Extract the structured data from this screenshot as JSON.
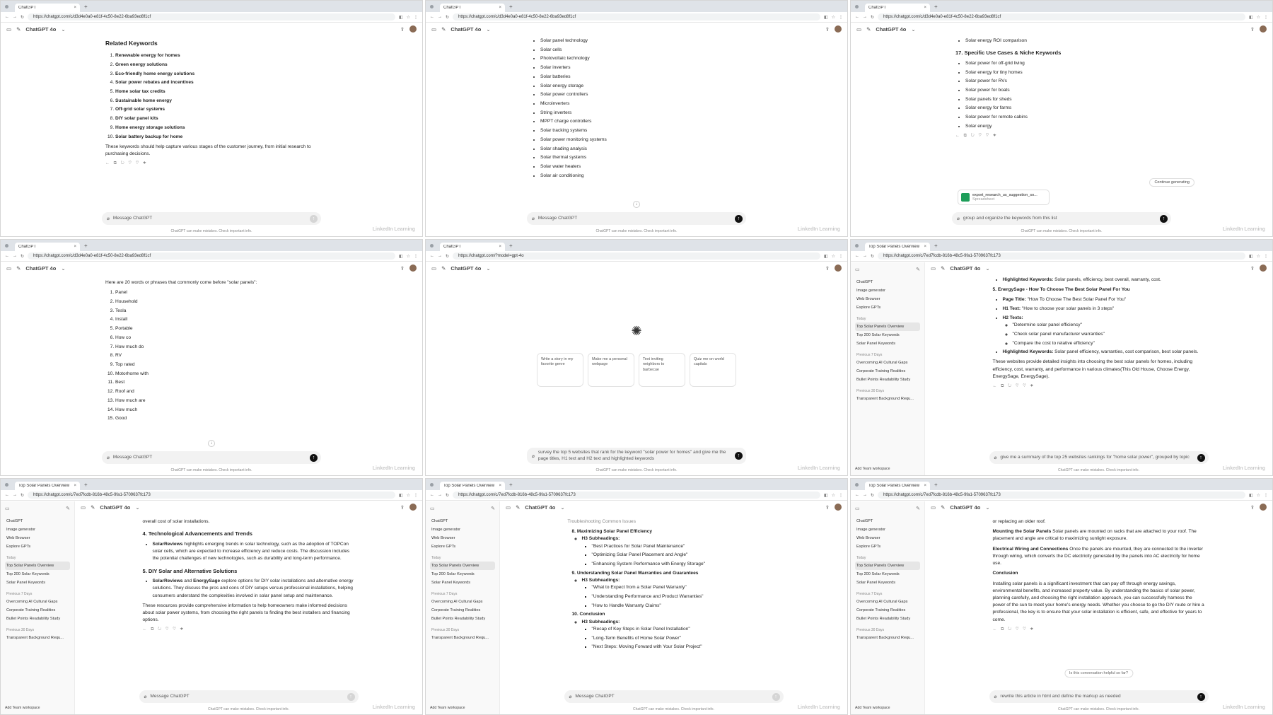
{
  "common": {
    "model": "ChatGPT 4o",
    "placeholder": "Message ChatGPT",
    "disclaimer": "ChatGPT can make mistakes. Check important info.",
    "watermark": "LinkedIn Learning",
    "actions": "← ⧉ ↻ ♡ ♡ ✦"
  },
  "panels": [
    {
      "tab": "ChatGPT",
      "url": "https://chatgpt.com/c/d3d4e0a0-e81f-4c50-8e22-6ba93ed8f1cf",
      "heading": "Related Keywords",
      "items": [
        "Renewable energy for homes",
        "Green energy solutions",
        "Eco-friendly home energy solutions",
        "Solar power rebates and incentives",
        "Home solar tax credits",
        "Sustainable home energy",
        "Off-grid solar systems",
        "DIY solar panel kits",
        "Home energy storage solutions",
        "Solar battery backup for home"
      ],
      "para": "These keywords should help capture various stages of the customer journey, from initial research to purchasing decisions."
    },
    {
      "tab": "ChatGPT",
      "url": "https://chatgpt.com/c/d3d4e0a0-e81f-4c50-8e22-6ba93ed8f1cf",
      "items": [
        "Solar panel technology",
        "Solar cells",
        "Photovoltaic technology",
        "Solar inverters",
        "Solar batteries",
        "Solar energy storage",
        "Solar power controllers",
        "Microinverters",
        "String inverters",
        "MPPT charge controllers",
        "Solar tracking systems",
        "Solar power monitoring systems",
        "Solar shading analysis",
        "Solar thermal systems",
        "Solar water heaters",
        "Solar air conditioning"
      ]
    },
    {
      "tab": "ChatGPT",
      "url": "https://chatgpt.com/c/d3d4e0a0-e81f-4c50-8e22-6ba93ed8f1cf",
      "top_item": "Solar energy ROI comparison",
      "heading": "17. Specific Use Cases & Niche Keywords",
      "items": [
        "Solar power for off-grid living",
        "Solar energy for tiny homes",
        "Solar power for RVs",
        "Solar power for boats",
        "Solar panels for sheds",
        "Solar energy for farms",
        "Solar power for remote cabins",
        "Solar energy"
      ],
      "continue": "Continue generating",
      "file_name": "export_research_us_suggestion_so...",
      "file_type": "Spreadsheet",
      "input": "group and organize the keywords from this list"
    },
    {
      "tab": "ChatGPT",
      "url": "https://chatgpt.com/c/d3d4e0a0-e81f-4c50-8e22-6ba93ed8f1cf",
      "intro": "Here are 20 words or phrases that commonly come before \"solar panels\":",
      "items": [
        "Panel",
        "Household",
        "Tesla",
        "Install",
        "Portable",
        "How co",
        "How much do",
        "RV",
        "Top rated",
        "Motorhome with",
        "Best",
        "Roof and",
        "How much are",
        "How much",
        "Good"
      ]
    },
    {
      "tab": "ChatGPT",
      "url": "https://chatgpt.com/?model=gpt-4o",
      "cards": [
        "Write a story in my favorite genre",
        "Make me a personal webpage",
        "Text inviting neighbors to barbecue",
        "Quiz me on world capitals"
      ],
      "input": "survey the top 5 websites that rank for the keyword \"solar power for homes\" and give me the page titles, H1 text and H2 text and highlighted keywords"
    },
    {
      "tab": "Top Solar Panels Overview",
      "url": "https://chatgpt.com/c/7ed7fcdb-816b-48c5-9fa1-5709637fc173",
      "hl1_label": "Highlighted Keywords:",
      "hl1": "Solar panels, efficiency, best overall, warranty, cost.",
      "site": "5. EnergySage - How To Choose The Best Solar Panel For You",
      "page_title_label": "Page Title:",
      "page_title": "\"How To Choose The Best Solar Panel For You\"",
      "h1_label": "H1 Text:",
      "h1": "\"How to choose your solar panels in 3 steps\"",
      "h2_label": "H2 Texts:",
      "h2s": [
        "\"Determine solar panel efficiency\"",
        "\"Check solar panel manufacturer warranties\"",
        "\"Compare the cost to relative efficiency\""
      ],
      "hl2_label": "Highlighted Keywords:",
      "hl2": "Solar panel efficiency, warranties, cost comparison, best solar panels.",
      "para": "These websites provide detailed insights into choosing the best solar panels for homes, including efficiency, cost, warranty, and performance in various climates(This Old House, Choose Energy, EnergySage, EnergySage).",
      "input": "give me a summary of the top 25 websites rankings for \"home solar power\", grouped by topic"
    },
    {
      "tab": "Top Solar Panels Overview",
      "url": "https://chatgpt.com/c/7ed7fcdb-816b-48c5-9fa1-5709637fc173",
      "top_line": "overall cost of solar installations.",
      "heading1": "4. Technological Advancements and Trends",
      "b1_bold": "SolarReviews",
      "b1": " highlights emerging trends in solar technology, such as the adoption of TOPCon solar cells, which are expected to increase efficiency and reduce costs. The discussion includes the potential challenges of new technologies, such as durability and long-term performance.",
      "heading2": "5. DIY Solar and Alternative Solutions",
      "b2_bold": "SolarReviews",
      "b2_and": " and ",
      "b2_bold2": "EnergySage",
      "b2": " explore options for DIY solar installations and alternative energy solutions. They discuss the pros and cons of DIY setups versus professional installations, helping consumers understand the complexities involved in solar panel setup and maintenance.",
      "para": "These resources provide comprehensive information to help homeowners make informed decisions about solar power systems, from choosing the right panels to finding the best installers and financing options."
    },
    {
      "tab": "Top Solar Panels Overview",
      "url": "https://chatgpt.com/c/7ed7fcdb-816b-48c5-9fa1-5709637fc173",
      "top_line": "Troubleshooting Common Issues",
      "sections": [
        {
          "title": "8. Maximizing Solar Panel Efficiency",
          "sub": "H3 Subheadings:",
          "items": [
            "\"Best Practices for Solar Panel Maintenance\"",
            "\"Optimizing Solar Panel Placement and Angle\"",
            "\"Enhancing System Performance with Energy Storage\""
          ]
        },
        {
          "title": "9. Understanding Solar Panel Warranties and Guarantees",
          "sub": "H3 Subheadings:",
          "items": [
            "\"What to Expect from a Solar Panel Warranty\"",
            "\"Understanding Performance and Product Warranties\"",
            "\"How to Handle Warranty Claims\""
          ]
        },
        {
          "title": "10. Conclusion",
          "sub": "H3 Subheadings:",
          "items": [
            "\"Recap of Key Steps in Solar Panel Installation\"",
            "\"Long-Term Benefits of Home Solar Power\"",
            "\"Next Steps: Moving Forward with Your Solar Project\""
          ]
        }
      ]
    },
    {
      "tab": "Top Solar Panels Overview",
      "url": "https://chatgpt.com/c/7ed7fcdb-816b-48c5-9fa1-5709637fc173",
      "top_line": "or replacing an older roof.",
      "p1_bold": "Mounting the Solar Panels",
      "p1": " Solar panels are mounted on racks that are attached to your roof. The placement and angle are critical to maximizing sunlight exposure.",
      "p2_bold": "Electrical Wiring and Connections",
      "p2": " Once the panels are mounted, they are connected to the inverter through wiring, which converts the DC electricity generated by the panels into AC electricity for home use.",
      "concl": "Conclusion",
      "p3": "Installing solar panels is a significant investment that can pay off through energy savings, environmental benefits, and increased property value. By understanding the basics of solar power, planning carefully, and choosing the right installation approach, you can successfully harness the power of the sun to meet your home's energy needs. Whether you choose to go the DIY route or hire a professional, the key is to ensure that your solar installation is efficient, safe, and effective for years to come.",
      "helpful": "Is this conversation helpful so far?",
      "input": "rewrite this article in html and define the markup as needed"
    }
  ],
  "sidebar": {
    "items": [
      "ChatGPT",
      "Image generator",
      "Web Browser",
      "Explore GPTs"
    ],
    "today_label": "Today",
    "today": [
      "Top Solar Panels Overview",
      "Top 200 Solar Keywords",
      "Solar Panel Keywords"
    ],
    "prev7_label": "Previous 7 Days",
    "prev7": [
      "Overcoming AI Cultural Gaps",
      "Corporate Training Realities",
      "Bullet Points Readability Study"
    ],
    "prev30_label": "Previous 30 Days",
    "prev30": [
      "Transparent Background Requ..."
    ],
    "footer": "Add Team workspace"
  }
}
